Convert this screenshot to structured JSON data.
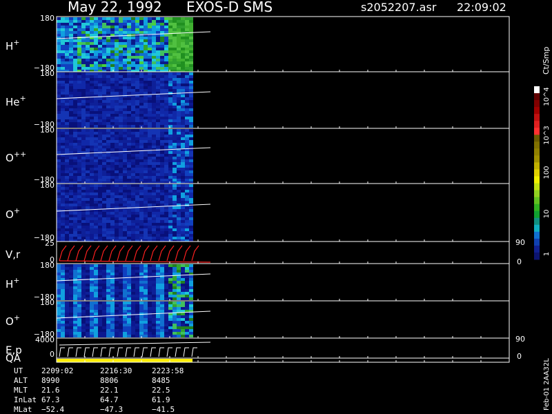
{
  "header": {
    "date": "May 22, 1992",
    "instrument": "EXOS-D SMS",
    "file": "s2052207.asr",
    "time": "22:09:02"
  },
  "colorbar": {
    "unit": "Ct/Smp",
    "labels": [
      "10^4",
      "10^3",
      "100",
      "10",
      "1"
    ]
  },
  "chart_data": {
    "type": "heatmap",
    "panels": [
      {
        "label": "H",
        "sup": "+",
        "ytop": "180",
        "ybot": "−180",
        "ylim": [
          -180,
          180
        ]
      },
      {
        "label": "He",
        "sup": "+",
        "ytop": "180",
        "ybot": "−180",
        "ylim": [
          -180,
          180
        ]
      },
      {
        "label": "O",
        "sup": "++",
        "ytop": "180",
        "ybot": "−180",
        "ylim": [
          -180,
          180
        ]
      },
      {
        "label": "O",
        "sup": "+",
        "ytop": "180",
        "ybot": "−180",
        "ylim": [
          -180,
          180
        ]
      },
      {
        "label": "V,r",
        "sup": "",
        "ytop": "25",
        "ybot": "0",
        "right_top": "90",
        "right_bot": "0",
        "ylim": [
          0,
          25
        ]
      },
      {
        "label": "H",
        "sup": "+",
        "ytop": "180",
        "ybot": "−180",
        "ylim": [
          -180,
          180
        ]
      },
      {
        "label": "O",
        "sup": "+",
        "ytop": "180",
        "ybot": "−180",
        "ylim": [
          -180,
          180
        ]
      },
      {
        "label": "E,p",
        "sup": "",
        "ytop": "4000",
        "ybot": "0",
        "right_top": "90",
        "right_bot": "0",
        "ylim": [
          0,
          4000
        ]
      },
      {
        "label": "QA",
        "sup": "",
        "ytop": "",
        "ybot": "",
        "ylim": [
          0,
          1
        ]
      }
    ],
    "x_extent_fraction": 0.3,
    "color_scale": "log",
    "color_range": [
      1,
      10000
    ]
  },
  "orbit_table": {
    "rows": [
      {
        "name": "UT",
        "values": [
          "2209:02",
          "2216:30",
          "2223:58"
        ]
      },
      {
        "name": "ALT",
        "values": [
          "8990",
          "8806",
          "8485"
        ]
      },
      {
        "name": "MLT",
        "values": [
          "21.6",
          "22.1",
          "22.5"
        ]
      },
      {
        "name": "InLat",
        "values": [
          "67.3",
          "64.7",
          "61.9"
        ]
      },
      {
        "name": "MLat",
        "values": [
          "−52.4",
          "−47.3",
          "−41.5"
        ]
      }
    ]
  },
  "footer": {
    "version": "Feb-01 2AA32L"
  },
  "colors": {
    "frame": "#ffffff",
    "velocity_trace": "#ff2020",
    "qa_bar": "#ffee00"
  }
}
